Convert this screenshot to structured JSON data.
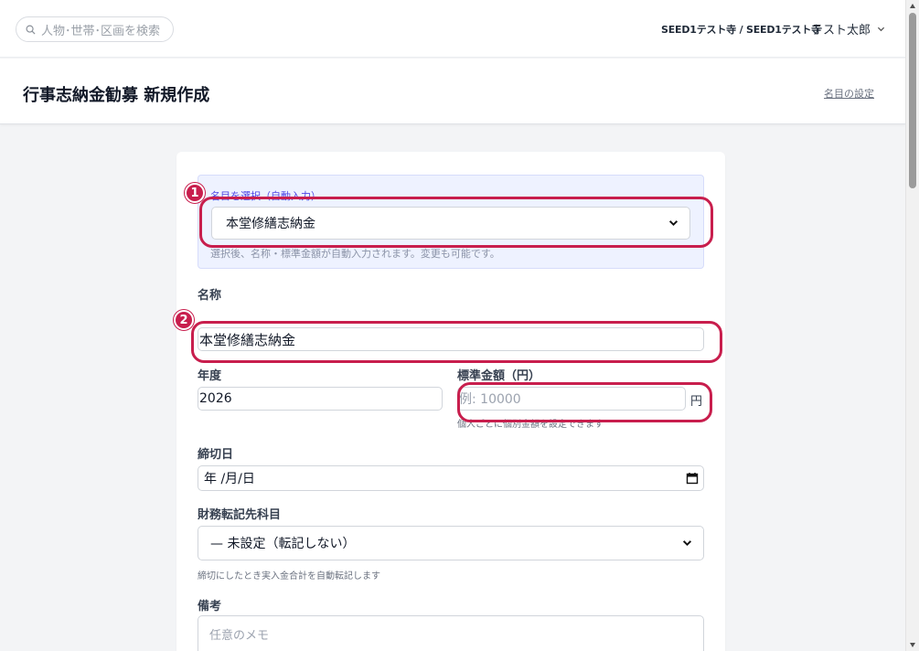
{
  "topbar": {
    "search_placeholder": "人物･世帯･区画を検索",
    "temple": "SEED1テスト寺 / SEED1テスト寺",
    "user_name": "テスト太郎"
  },
  "header": {
    "title": "行事志納金勧募 新規作成",
    "settings_link": "名目の設定"
  },
  "form": {
    "preset": {
      "label": "名目を選択（自動入力）",
      "value": "本堂修繕志納金",
      "hint": "選択後、名称・標準金額が自動入力されます。変更も可能です。"
    },
    "name": {
      "label": "名称",
      "value": "本堂修繕志納金"
    },
    "year": {
      "label": "年度",
      "value": "2026"
    },
    "amount": {
      "label": "標準金額（円）",
      "placeholder": "例: 10000",
      "unit": "円",
      "hint": "個人ごとに個別金額を設定できます"
    },
    "deadline": {
      "label": "締切日",
      "value": "年 /月/日"
    },
    "account": {
      "label": "財務転記先科目",
      "value": "— 未設定（転記しない）",
      "hint": "締切にしたとき実入金合計を自動転記します"
    },
    "notes": {
      "label": "備考",
      "placeholder": "任意のメモ"
    }
  },
  "annotations": {
    "badge_1": "1",
    "badge_2": "2"
  },
  "colors": {
    "highlight": "#c81e4d",
    "accent": "#4f46e5",
    "preset_bg": "#eef2ff"
  }
}
